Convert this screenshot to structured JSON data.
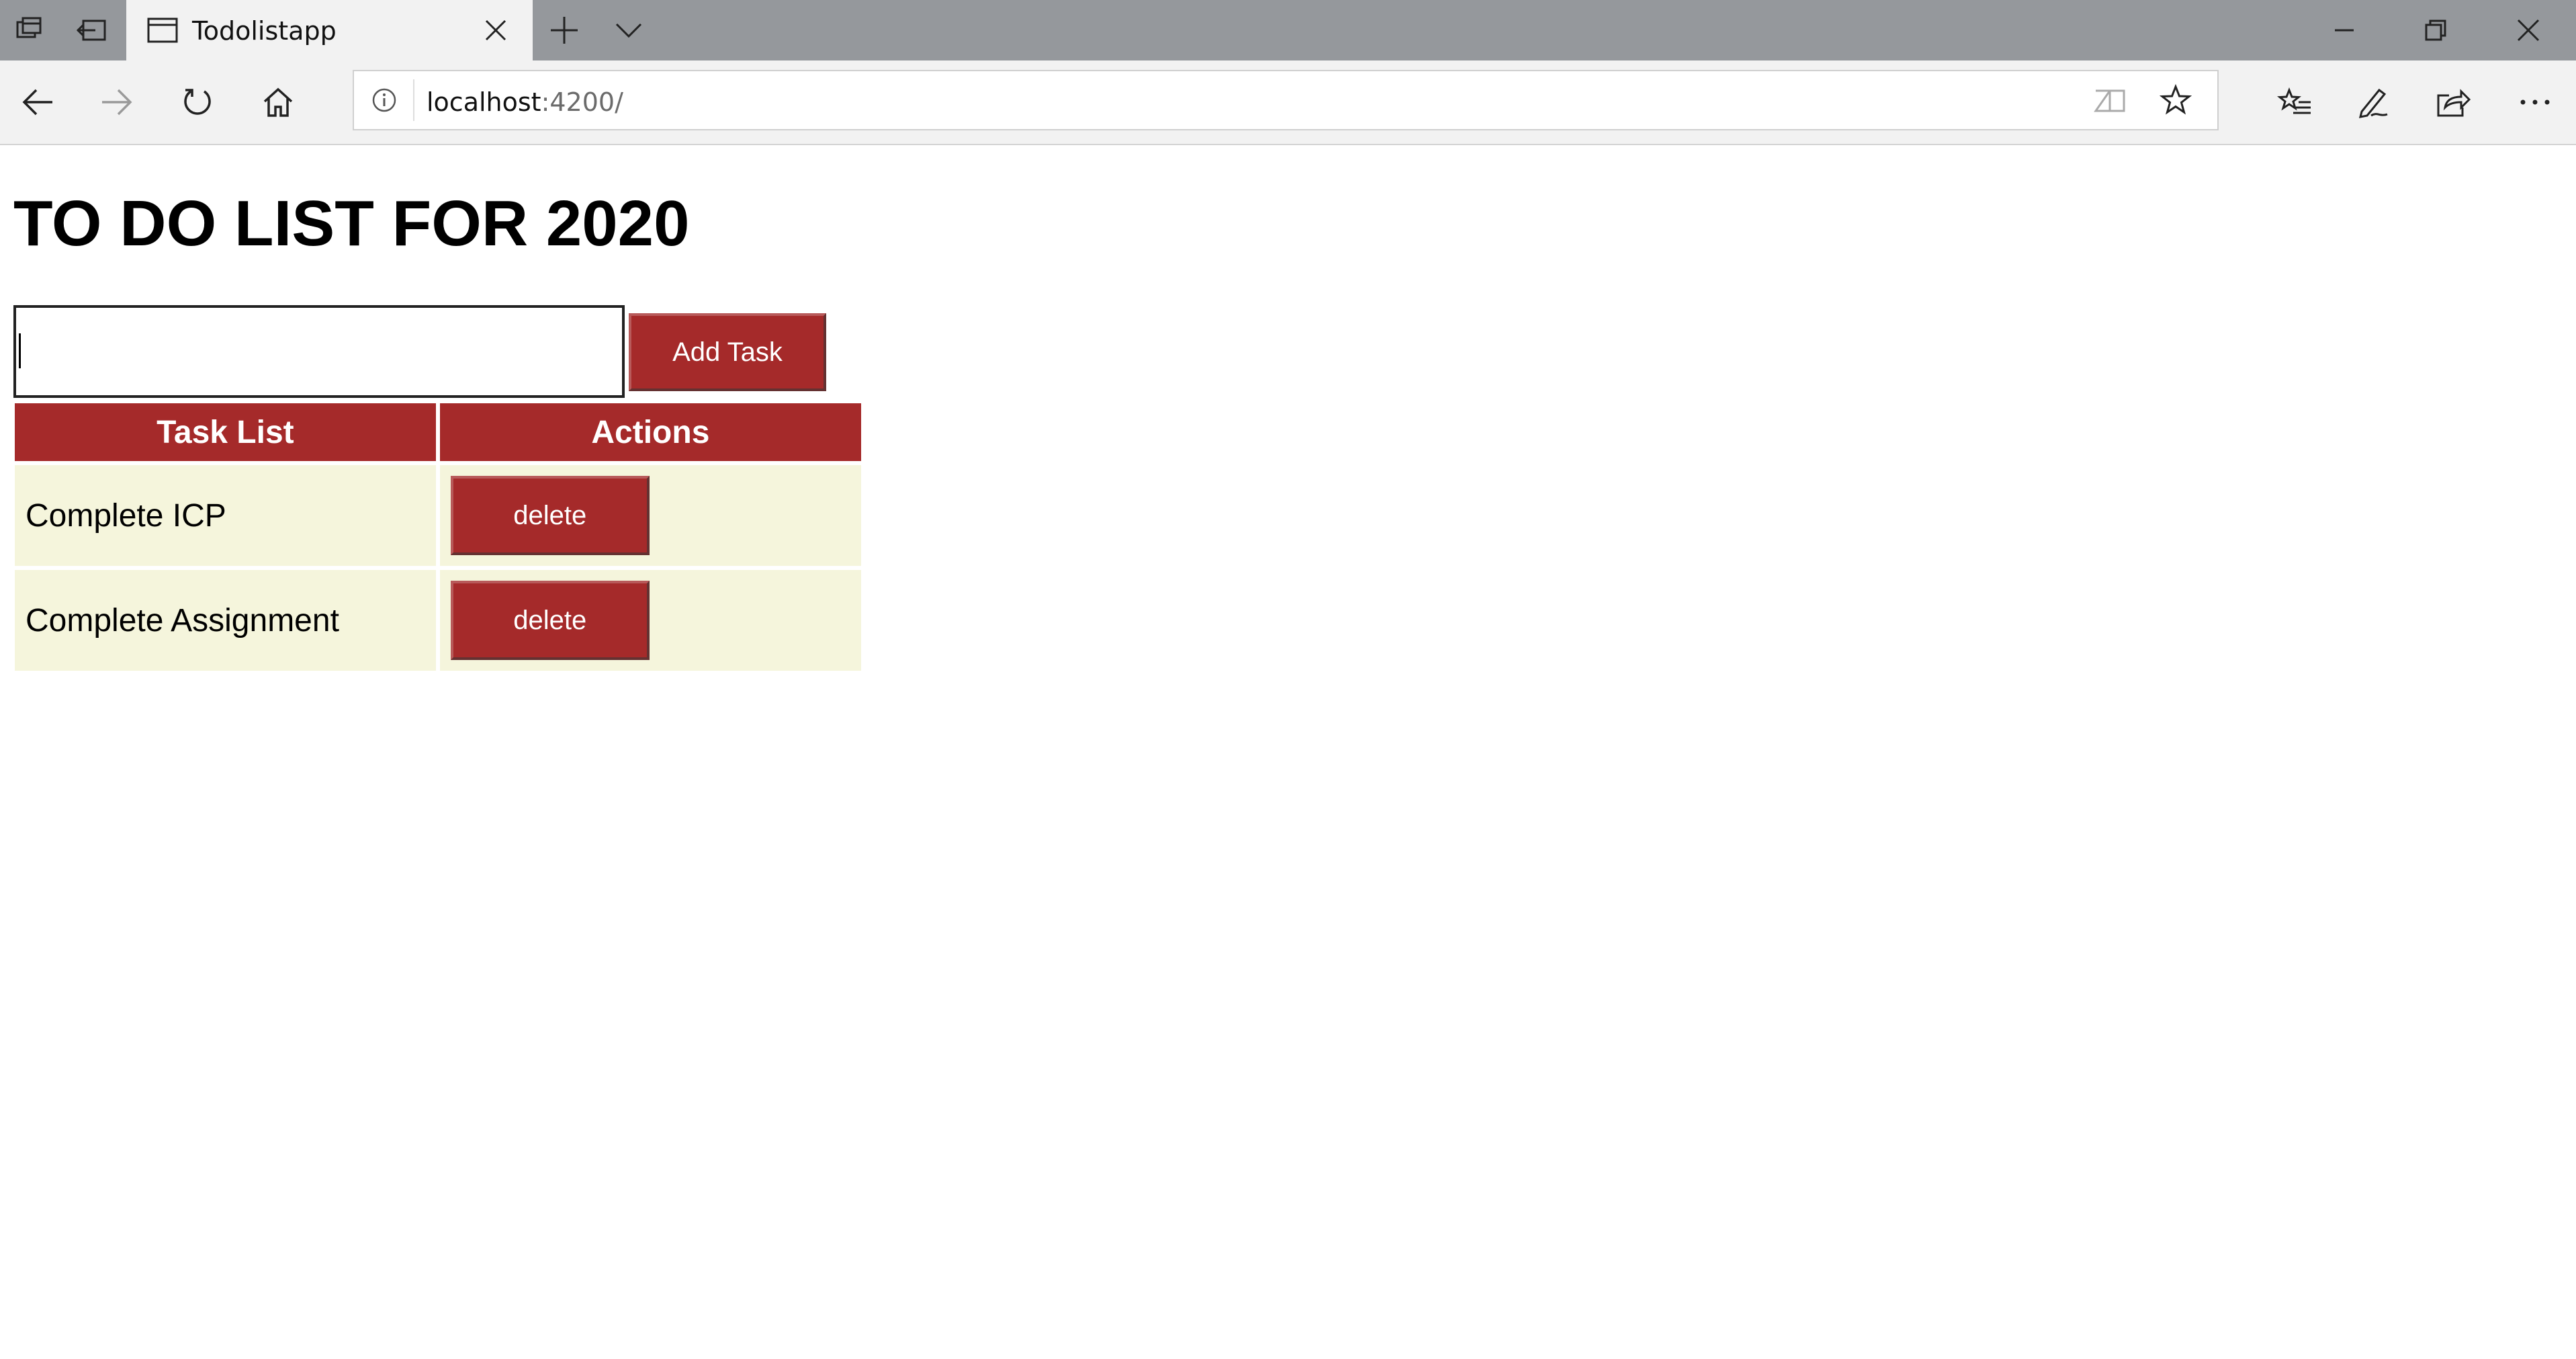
{
  "browser": {
    "tab_title": "Todolistapp",
    "url_host": "localhost",
    "url_rest": ":4200/"
  },
  "page": {
    "heading": "TO DO LIST FOR 2020",
    "task_input": {
      "value": "",
      "placeholder": ""
    },
    "add_button_label": "Add Task",
    "table": {
      "headers": [
        "Task List",
        "Actions"
      ],
      "rows": [
        {
          "task": "Complete ICP",
          "action_label": "delete"
        },
        {
          "task": "Complete Assignment",
          "action_label": "delete"
        }
      ]
    }
  },
  "colors": {
    "primary": "#a52a2a",
    "row_bg": "#f5f5dc",
    "tabbar_bg": "#95989c",
    "toolbar_bg": "#f2f2f2"
  },
  "icons": {
    "tabbar": [
      "tabs-aside-icon",
      "restore-tabs-icon",
      "page-icon",
      "close-tab-icon",
      "new-tab-icon",
      "tab-preview-chevron-icon",
      "minimize-icon",
      "restore-window-icon",
      "close-window-icon"
    ],
    "toolbar": [
      "back-icon",
      "forward-icon",
      "refresh-icon",
      "home-icon",
      "info-icon",
      "reading-view-icon",
      "favorite-star-icon",
      "favorites-list-icon",
      "pen-icon",
      "share-icon",
      "more-icon"
    ]
  }
}
